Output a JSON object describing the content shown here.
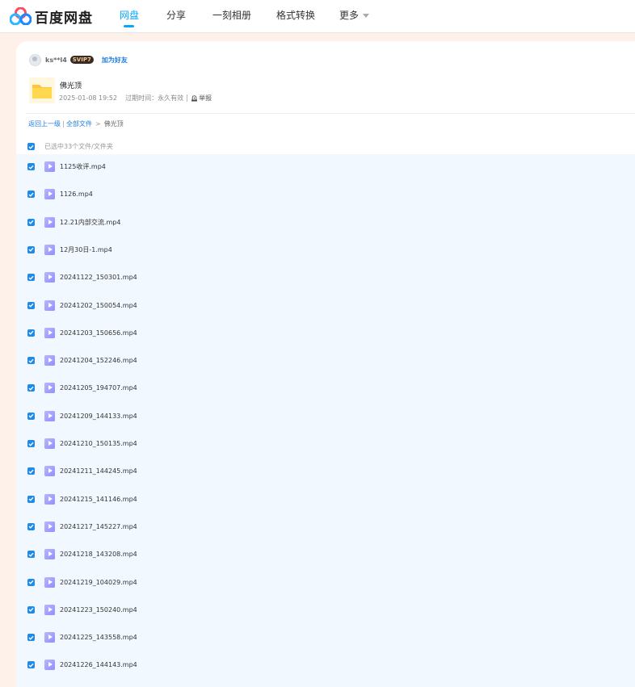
{
  "header": {
    "brand": "百度网盘",
    "nav": [
      {
        "label": "网盘",
        "active": true
      },
      {
        "label": "分享",
        "active": false
      },
      {
        "label": "一刻相册",
        "active": false
      },
      {
        "label": "格式转换",
        "active": false
      },
      {
        "label": "更多",
        "active": false
      }
    ]
  },
  "share": {
    "username": "ks**l4",
    "vip_badge": "SVIP7",
    "add_friend": "加为好友",
    "folder_name": "佛光顶",
    "date": "2025-01-08 19:52",
    "expire_label": "过期时间：",
    "expire_value": "永久有效",
    "report": "举报"
  },
  "breadcrumb": {
    "back": "返回上一级",
    "all_files": "全部文件",
    "separator": ">",
    "current": "佛光顶"
  },
  "selection": {
    "summary": "已选中33个文件/文件夹",
    "checked": true
  },
  "files": [
    {
      "name": "1125收评.mp4",
      "checked": true
    },
    {
      "name": "1126.mp4",
      "checked": true
    },
    {
      "name": "12.21内部交流.mp4",
      "checked": true
    },
    {
      "name": "12月30日-1.mp4",
      "checked": true
    },
    {
      "name": "20241122_150301.mp4",
      "checked": true
    },
    {
      "name": "20241202_150054.mp4",
      "checked": true
    },
    {
      "name": "20241203_150656.mp4",
      "checked": true
    },
    {
      "name": "20241204_152246.mp4",
      "checked": true
    },
    {
      "name": "20241205_194707.mp4",
      "checked": true
    },
    {
      "name": "20241209_144133.mp4",
      "checked": true
    },
    {
      "name": "20241210_150135.mp4",
      "checked": true
    },
    {
      "name": "20241211_144245.mp4",
      "checked": true
    },
    {
      "name": "20241215_141146.mp4",
      "checked": true
    },
    {
      "name": "20241217_145227.mp4",
      "checked": true
    },
    {
      "name": "20241218_143208.mp4",
      "checked": true
    },
    {
      "name": "20241219_104029.mp4",
      "checked": true
    },
    {
      "name": "20241223_150240.mp4",
      "checked": true
    },
    {
      "name": "20241225_143558.mp4",
      "checked": true
    },
    {
      "name": "20241226_144143.mp4",
      "checked": true
    }
  ],
  "colors": {
    "accent": "#06a7ff",
    "link": "#1e7ee0",
    "checkbox": "#1e8be8",
    "list_bg": "#f2f8ff",
    "page_bg": "#fdf1ea",
    "video_icon": "#9e9cff"
  },
  "icons": {
    "logo": "baidu-netdisk-logo",
    "folder": "folder-icon",
    "video": "video-file-icon",
    "checkbox": "checkbox-checked-icon",
    "report": "report-icon",
    "more": "caret-down-icon"
  }
}
